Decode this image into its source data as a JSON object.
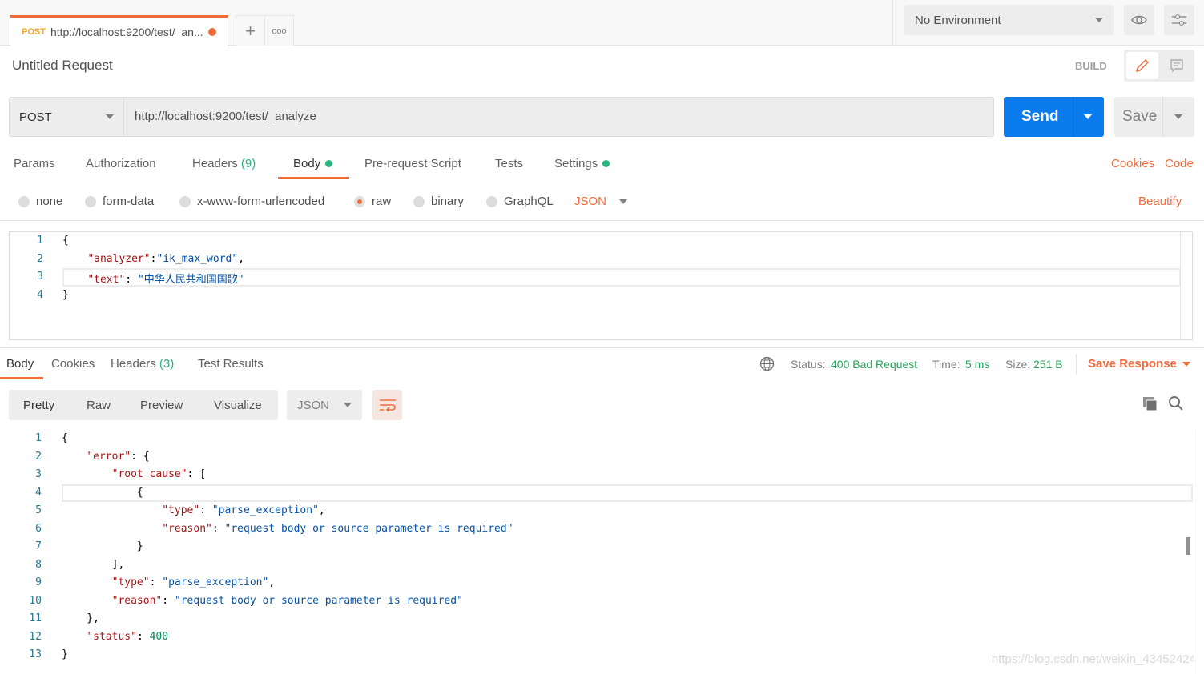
{
  "tab": {
    "method": "POST",
    "url": "http://localhost:9200/test/_an..."
  },
  "environment": {
    "selected": "No Environment"
  },
  "request": {
    "title": "Untitled Request",
    "mode_label": "BUILD",
    "method": "POST",
    "url": "http://localhost:9200/test/_analyze",
    "send_label": "Send",
    "save_label": "Save"
  },
  "request_tabs": [
    "Params",
    "Authorization",
    "Headers",
    "(9)",
    "Body",
    "Pre-request Script",
    "Tests",
    "Settings"
  ],
  "request_links": {
    "cookies": "Cookies",
    "code": "Code"
  },
  "body_types": [
    "none",
    "form-data",
    "x-www-form-urlencoded",
    "raw",
    "binary",
    "GraphQL"
  ],
  "body_format": "JSON",
  "beautify": "Beautify",
  "request_body": [
    [
      [
        "p",
        "{"
      ]
    ],
    [
      [
        "p",
        "    "
      ],
      [
        "k",
        "\"analyzer\""
      ],
      [
        "p",
        ":"
      ],
      [
        "s",
        "\"ik_max_word\""
      ],
      [
        "p",
        ","
      ]
    ],
    [
      [
        "p",
        "    "
      ],
      [
        "k",
        "\"text\""
      ],
      [
        "p",
        ": "
      ],
      [
        "s",
        "\"中华人民共和国国歌\""
      ]
    ],
    [
      [
        "p",
        "}"
      ]
    ]
  ],
  "response_tabs": {
    "body": "Body",
    "cookies": "Cookies",
    "headers": "Headers",
    "headers_count": "(3)",
    "tests": "Test Results"
  },
  "status": {
    "status_label": "Status:",
    "status_value": "400 Bad Request",
    "time_label": "Time:",
    "time_value": "5 ms",
    "size_label": "Size:",
    "size_value": "251 B",
    "save_response": "Save Response"
  },
  "view_tabs": [
    "Pretty",
    "Raw",
    "Preview",
    "Visualize"
  ],
  "response_format": "JSON",
  "response_body": [
    [
      [
        "p",
        "{"
      ]
    ],
    [
      [
        "p",
        "    "
      ],
      [
        "k",
        "\"error\""
      ],
      [
        "p",
        ": {"
      ]
    ],
    [
      [
        "p",
        "        "
      ],
      [
        "k",
        "\"root_cause\""
      ],
      [
        "p",
        ": ["
      ]
    ],
    [
      [
        "p",
        "            {"
      ]
    ],
    [
      [
        "p",
        "                "
      ],
      [
        "k",
        "\"type\""
      ],
      [
        "p",
        ": "
      ],
      [
        "s",
        "\"parse_exception\""
      ],
      [
        "p",
        ","
      ]
    ],
    [
      [
        "p",
        "                "
      ],
      [
        "k",
        "\"reason\""
      ],
      [
        "p",
        ": "
      ],
      [
        "s",
        "\"request body or source parameter is required\""
      ]
    ],
    [
      [
        "p",
        "            }"
      ]
    ],
    [
      [
        "p",
        "        ],"
      ]
    ],
    [
      [
        "p",
        "        "
      ],
      [
        "k",
        "\"type\""
      ],
      [
        "p",
        ": "
      ],
      [
        "s",
        "\"parse_exception\""
      ],
      [
        "p",
        ","
      ]
    ],
    [
      [
        "p",
        "        "
      ],
      [
        "k",
        "\"reason\""
      ],
      [
        "p",
        ": "
      ],
      [
        "s",
        "\"request body or source parameter is required\""
      ]
    ],
    [
      [
        "p",
        "    },"
      ]
    ],
    [
      [
        "p",
        "    "
      ],
      [
        "k",
        "\"status\""
      ],
      [
        "p",
        ": "
      ],
      [
        "n",
        "400"
      ]
    ],
    [
      [
        "p",
        "}"
      ]
    ]
  ],
  "watermark": "https://blog.csdn.net/weixin_43452424",
  "colors": {
    "accent": "#f26b3a",
    "send": "#097bed",
    "success": "#26b47f"
  }
}
